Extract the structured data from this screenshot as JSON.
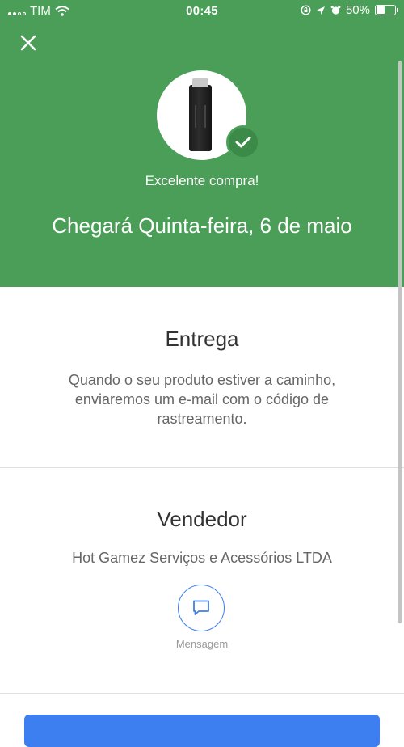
{
  "status_bar": {
    "carrier": "TIM",
    "time": "00:45",
    "battery": "50%",
    "battery_level": 0.5,
    "icons": [
      "signal-icon",
      "wifi-icon",
      "screen-lock-icon",
      "location-icon",
      "alarm-icon",
      "battery-icon"
    ]
  },
  "header": {
    "close_icon": "close-icon",
    "product_image": "fire-tv-stick",
    "badge_icon": "check-icon",
    "subtitle": "Excelente compra!",
    "title": "Chegará Quinta-feira, 6 de maio"
  },
  "delivery": {
    "title": "Entrega",
    "text": "Quando o seu produto estiver a caminho, enviaremos um e-mail com o código de rastreamento."
  },
  "seller": {
    "title": "Vendedor",
    "name": "Hot Gamez Serviços e Acessórios LTDA",
    "message_icon": "chat-bubble-icon",
    "message_label": "Mensagem"
  },
  "colors": {
    "header_green": "#4a9e57",
    "badge_green": "#3b8a48",
    "accent_blue": "#3d7ef0"
  }
}
